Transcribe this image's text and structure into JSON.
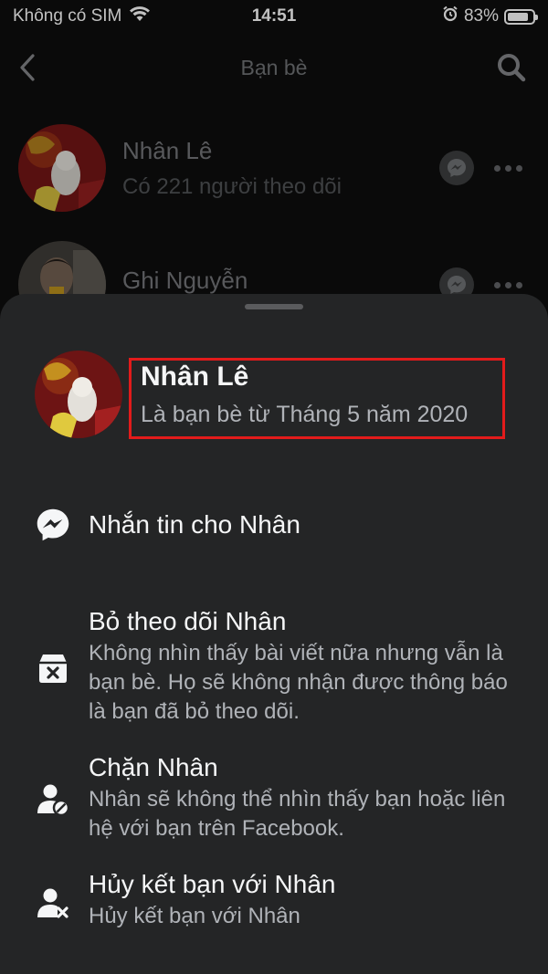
{
  "status_bar": {
    "carrier": "Không có SIM",
    "time": "14:51",
    "battery": "83%",
    "battery_level": 0.83
  },
  "header": {
    "title": "Bạn bè"
  },
  "friends": [
    {
      "name": "Nhân Lê",
      "subtitle": "Có 221 người theo dõi"
    },
    {
      "name": "Ghi Nguyễn",
      "subtitle": ""
    }
  ],
  "sheet": {
    "profile": {
      "name": "Nhân Lê",
      "subtitle": "Là bạn bè từ Tháng 5 năm 2020"
    },
    "actions": [
      {
        "title": "Nhắn tin cho Nhân",
        "desc": ""
      },
      {
        "title": "Bỏ theo dõi Nhân",
        "desc": "Không nhìn thấy bài viết nữa nhưng vẫn là bạn bè. Họ sẽ không nhận được thông báo là bạn đã bỏ theo dõi."
      },
      {
        "title": "Chặn Nhân",
        "desc": "Nhân sẽ không thể nhìn thấy bạn hoặc liên hệ với bạn trên Facebook."
      },
      {
        "title": "Hủy kết bạn với Nhân",
        "desc": "Hủy kết bạn với Nhân"
      }
    ]
  },
  "colors": {
    "sheet_bg": "#242526",
    "highlight": "#e21b1b",
    "text_primary": "#f5f6f7",
    "text_secondary": "#b0b3b8"
  },
  "icons": [
    "wifi-icon",
    "alarm-icon",
    "back-icon",
    "search-icon",
    "messenger-icon",
    "unfollow-icon",
    "block-icon",
    "unfriend-icon",
    "more-icon"
  ]
}
